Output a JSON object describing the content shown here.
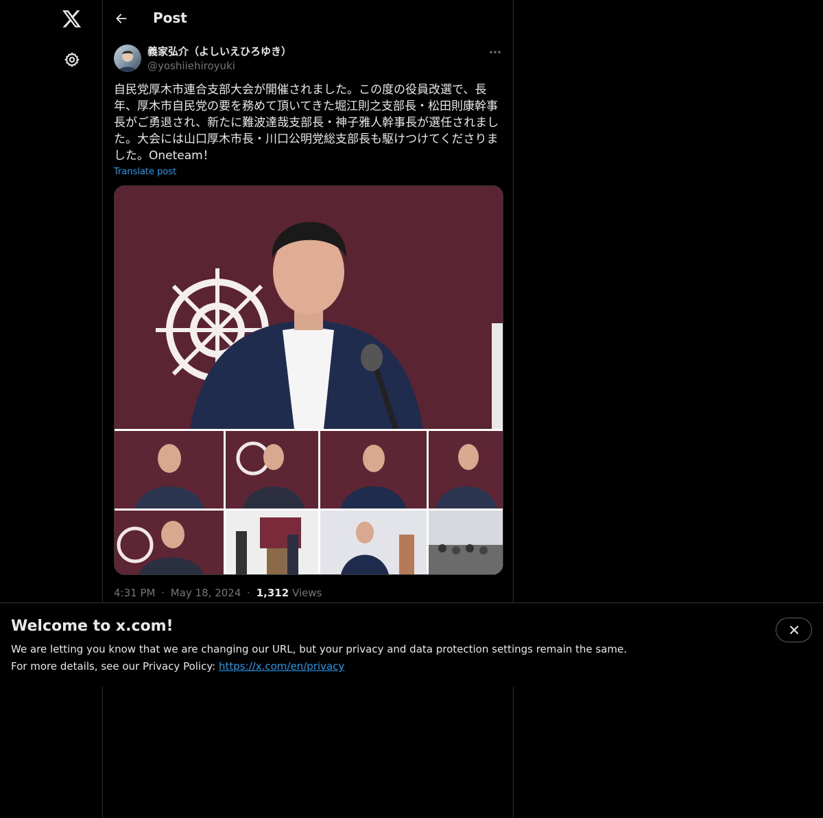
{
  "header": {
    "title": "Post"
  },
  "author": {
    "name": "義家弘介（よしいえひろゆき）",
    "handle": "@yoshiiehiroyuki"
  },
  "post": {
    "text": "自民党厚木市連合支部大会が開催されました。この度の役員改選で、長年、厚木市自民党の要を務めて頂いてきた堀江則之支部長・松田則康幹事長がご勇退され、新たに難波達哉支部長・神子雅人幹事長が選任されました。大会には山口厚木市長・川口公明党総支部長も駆けつけてくださりました。Oneteam！",
    "translate_label": "Translate post",
    "time": "4:31 PM",
    "date": "May 18, 2024",
    "views_count": "1,312",
    "views_label": "Views",
    "separator": "·"
  },
  "banner": {
    "title": "Welcome to x.com!",
    "line1": "We are letting you know that we are changing our URL, but your privacy and data protection settings remain the same.",
    "line2_prefix": "For more details, see our Privacy Policy: ",
    "link_text": "https://x.com/en/privacy"
  },
  "icons": {
    "logo": "x-logo-icon",
    "settings": "gear-icon",
    "back": "arrow-left-icon",
    "more": "more-horizontal-icon",
    "close": "close-icon"
  },
  "colors": {
    "background": "#000000",
    "text": "#e7e9ea",
    "secondary": "#71767b",
    "accent": "#1d9bf0",
    "border": "#2f3336"
  }
}
